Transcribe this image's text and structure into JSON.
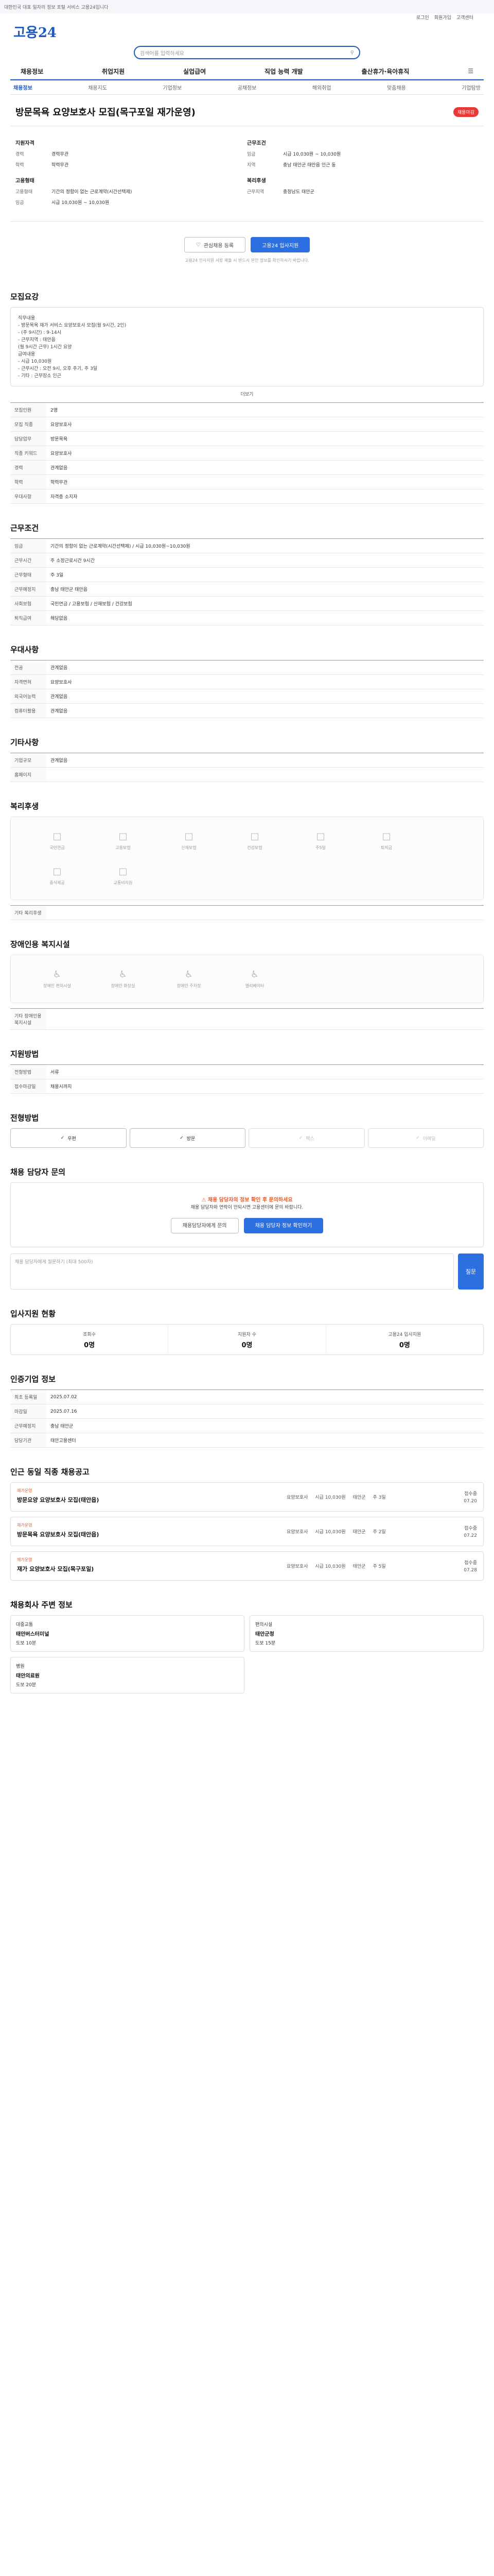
{
  "banner": "대한민국 대표 일자리 정보 포털 서비스 고용24입니다",
  "util": [
    "로그인",
    "회원가입",
    "고객센터"
  ],
  "logo": "고용24",
  "logo_sub": "",
  "search_placeholder": "검색어를 입력하세요",
  "gnb": [
    "채용정보",
    "취업지원",
    "실업급여",
    "직업 능력 개발",
    "출산휴가·육아휴직"
  ],
  "subnav": [
    "채용정보",
    "채용지도",
    "기업정보",
    "공채정보",
    "해외취업",
    "맞춤채용",
    "기업탐방"
  ],
  "job": {
    "org": "",
    "title": "방문목욕 요양보호사 모집(목구포일 재가운영)",
    "tag": "채용마감"
  },
  "summary": {
    "left_title": "지원자격",
    "left": [
      [
        "경력",
        "경력무관"
      ],
      [
        "학력",
        "학력무관"
      ]
    ],
    "left2_title": "고용형태",
    "left2": [
      [
        "고용형태",
        "기간의 정함이 없는 근로계약(시간선택제)"
      ],
      [
        "임금",
        "시급 10,030원 ~ 10,030원"
      ]
    ],
    "right_title": "근무조건",
    "right": [
      [
        "임금",
        "시급 10,030원 ~ 10,030원"
      ],
      [
        "지역",
        "충남 태안군 태안읍 인근 동"
      ]
    ],
    "right2_title": "복리후생",
    "right2": [
      [
        "근무지역",
        "충청남도 태안군"
      ]
    ]
  },
  "buttons": {
    "scrap": "관심채용 등록",
    "apply": "고용24 입사지원"
  },
  "notice": "고용24 인사지원 서류 제출 시 반드시 본인 정보를 확인하시기 바랍니다.",
  "sections": {
    "recruit": "모집요강",
    "work": "근무조건",
    "benefits": "우대사항",
    "company": "기타사항",
    "welfare": "복리후생",
    "disabled": "장애인용 복지시설",
    "apply": "지원방법",
    "apply_method": "전형방법",
    "contact": "채용 담당자 문의",
    "stats": "입사지원 현황",
    "history": "인증기업 정보",
    "recommend": "인근 동일 직종 채용공고",
    "nearby": "채용회사 주변 정보"
  },
  "recruit_text": [
    "직무내용",
    "- 방문목욕 재가 서비스 요양보호사 모집(월 9시간, 2인)",
    "- (주 9시간) : 9-14시",
    "- 근무지역 : 태안읍",
    "(월 9시간 근무) 1시간 요양",
    "급여내용",
    "- 시급 10,030원",
    "- 근무시간 : 오전 9시, 오후 주기, 주 3일",
    "- 기타 : 근무장소 인근"
  ],
  "recruit_more": "더보기",
  "recruit_grid": [
    [
      "모집인원",
      "2명"
    ],
    [
      "모집 직종",
      "요양보호사"
    ],
    [
      "담당업무",
      "방문목욕"
    ],
    [
      "직종 키워드",
      "요양보호사"
    ],
    [
      "경력",
      "관계없음"
    ],
    [
      "학력",
      "학력무관"
    ],
    [
      "우대사항",
      "자격증 소지자"
    ]
  ],
  "work_grid": [
    [
      "임금",
      "기간의 정함이 없는 근로계약(시간선택제) / 시급 10,030원~10,030원"
    ],
    [
      "근무시간",
      "주 소정근로시간 9시간"
    ],
    [
      "근무형태",
      "주 3일"
    ],
    [
      "근무예정지",
      "충남 태안군 태안읍"
    ],
    [
      "사회보험",
      "국민연금 / 고용보험 / 산재보험 / 건강보험"
    ],
    [
      "퇴직급여",
      "해당없음"
    ]
  ],
  "benefit_grid": [
    [
      "전공",
      "관계없음"
    ],
    [
      "자격면허",
      "요양보호사"
    ],
    [
      "외국어능력",
      "관계없음"
    ],
    [
      "컴퓨터활용",
      "관계없음"
    ]
  ],
  "company_grid": [
    [
      "기업규모",
      "관계없음"
    ],
    [
      "홈페이지",
      ""
    ]
  ],
  "welfare_items": [
    "국민연금",
    "고용보험",
    "산재보험",
    "건강보험",
    "주5일",
    "퇴직금",
    "중식제공",
    "교통비지원"
  ],
  "welfare_note": "기타 복리후생",
  "disabled_items": [
    "장애인 편의시설",
    "장애인 화장실",
    "장애인 주차장",
    "엘리베이터"
  ],
  "disabled_note": "기타 장애인용 복지시설",
  "apply_grid": [
    [
      "전형방법",
      "서류"
    ],
    [
      "접수마감일",
      "채용시까지"
    ]
  ],
  "apply_methods": [
    "우편",
    "방문",
    "팩스",
    "이메일"
  ],
  "contact": {
    "warn": "채용 담당자의 정보 확인 후 문의하세요",
    "text": "채용 담당자와 연락이 안되시면 고용센터에 문의 바랍니다.",
    "btn1": "채용담당자에게 문의",
    "btn2": "채용 담당자 정보 확인하기"
  },
  "question_placeholder": "채용 담당자에게 질문하기 (최대 500자)",
  "question_btn": "질문",
  "stats": [
    [
      "조회수",
      "0명"
    ],
    [
      "지원자 수",
      "0명"
    ],
    [
      "고용24 입사지원",
      "0명"
    ]
  ],
  "history_grid": [
    [
      "최초 등록일",
      "2025.07.02"
    ],
    [
      "마감일",
      "2025.07.16"
    ],
    [
      "근무예정지",
      "충남 태안군"
    ],
    [
      "담당기관",
      "태안고용센터"
    ]
  ],
  "recommend": [
    {
      "tag": "재가운영",
      "title": "방문요양 요양보호사 모집(태안읍)",
      "meta": [
        "요양보호사",
        "시급 10,030원",
        "태안군",
        "주 3일"
      ],
      "right": [
        "접수중",
        "07.20"
      ]
    },
    {
      "tag": "재가운영",
      "title": "방문목욕 요양보호사 모집(태안읍)",
      "meta": [
        "요양보호사",
        "시급 10,030원",
        "태안군",
        "주 2일"
      ],
      "right": [
        "접수중",
        "07.22"
      ]
    },
    {
      "tag": "재가운영",
      "title": "재가 요양보호사 모집(목구포일)",
      "meta": [
        "요양보호사",
        "시급 10,030원",
        "태안군",
        "주 5일"
      ],
      "right": [
        "접수중",
        "07.28"
      ]
    }
  ],
  "nearby": [
    {
      "tag": "대중교통",
      "title": "태안버스터미널",
      "meta": "도보 10분"
    },
    {
      "tag": "편의시설",
      "title": "태안군청",
      "meta": "도보 15분"
    },
    {
      "tag": "병원",
      "title": "태안의료원",
      "meta": "도보 20분"
    }
  ]
}
